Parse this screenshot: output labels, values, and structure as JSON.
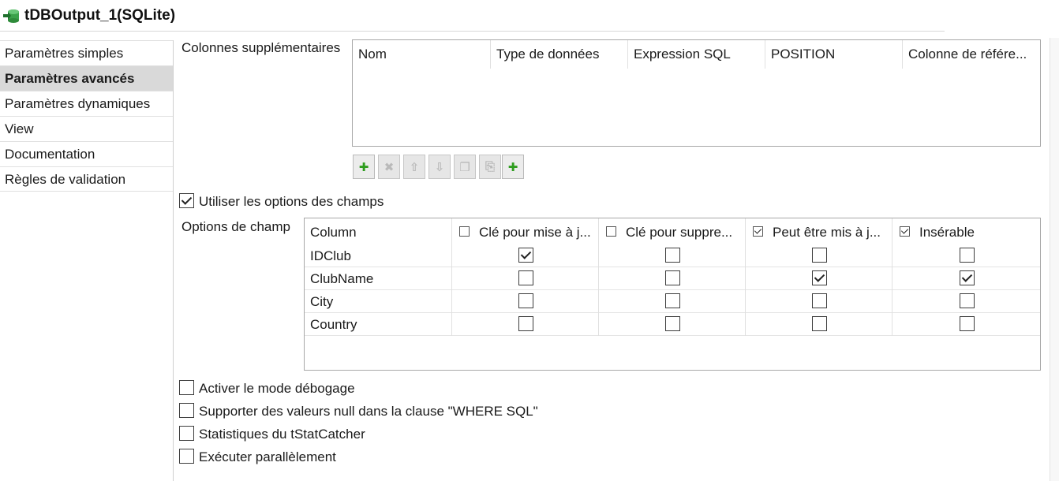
{
  "header": {
    "title": "tDBOutput_1(SQLite)",
    "icon": "db-output-icon"
  },
  "sidebar": {
    "items": [
      {
        "label": "Paramètres simples",
        "active": false
      },
      {
        "label": "Paramètres avancés",
        "active": true
      },
      {
        "label": "Paramètres dynamiques",
        "active": false
      },
      {
        "label": "View",
        "active": false
      },
      {
        "label": "Documentation",
        "active": false
      },
      {
        "label": "Règles de validation",
        "active": false
      }
    ]
  },
  "extra_columns": {
    "label": "Colonnes supplémentaires",
    "headers": [
      "Nom",
      "Type de données",
      "Expression SQL",
      "POSITION",
      "Colonne de référe..."
    ],
    "rows": []
  },
  "toolbar": {
    "buttons": [
      {
        "icon": "add-icon",
        "glyph": "✚",
        "enabled": true
      },
      {
        "icon": "delete-icon",
        "glyph": "✖",
        "enabled": false
      },
      {
        "icon": "move-up-icon",
        "glyph": "⇧",
        "enabled": false
      },
      {
        "icon": "move-down-icon",
        "glyph": "⇩",
        "enabled": false
      },
      {
        "icon": "copy-icon",
        "glyph": "❐",
        "enabled": false
      },
      {
        "icon": "paste-icon",
        "glyph": "⎘",
        "enabled": false
      },
      {
        "icon": "add-plus-icon",
        "glyph": "✚",
        "enabled": true
      }
    ]
  },
  "use_field_options": {
    "label": "Utiliser les options des champs",
    "checked": true
  },
  "field_options": {
    "label": "Options de champ",
    "headers": [
      {
        "label": "Column",
        "checkbox": null
      },
      {
        "label": "Clé pour mise à j...",
        "checkbox": false
      },
      {
        "label": "Clé pour suppre...",
        "checkbox": false
      },
      {
        "label": "Peut être mis à j...",
        "checkbox": true
      },
      {
        "label": "Insérable",
        "checkbox": true
      }
    ],
    "rows": [
      {
        "name": "IDClub",
        "values": [
          true,
          false,
          false,
          false
        ]
      },
      {
        "name": "ClubName",
        "values": [
          false,
          false,
          true,
          true
        ]
      },
      {
        "name": "City",
        "values": [
          false,
          false,
          false,
          false
        ]
      },
      {
        "name": "Country",
        "values": [
          false,
          false,
          false,
          false
        ]
      }
    ]
  },
  "options": [
    {
      "label": "Activer le mode débogage",
      "checked": false
    },
    {
      "label": "Supporter des valeurs null dans la clause \"WHERE SQL\"",
      "checked": false
    },
    {
      "label": "Statistiques du tStatCatcher",
      "checked": false
    },
    {
      "label": "Exécuter parallèlement",
      "checked": false
    }
  ],
  "colors": {
    "accent_green": "#2f9d1f",
    "active_tab_bg": "#d9d9d9",
    "border": "#a8a8a8"
  }
}
